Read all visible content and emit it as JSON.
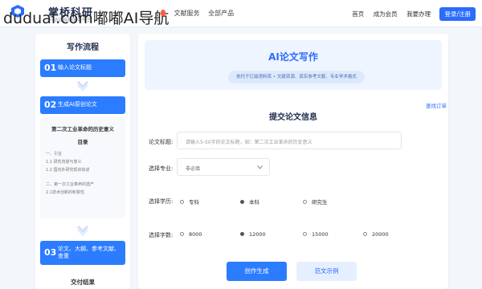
{
  "header": {
    "brand": "掌桥科研",
    "brand_sub": "一站式科研服务平台",
    "watermark": "duduai.com嘟嘟AI导航",
    "nav": [
      "文献服务",
      "全部产品"
    ],
    "right_nav": [
      "首页",
      "成为会员",
      "我要办理"
    ],
    "login_label": "登录/注册"
  },
  "left": {
    "title": "写作流程",
    "steps": [
      {
        "num": "01",
        "text": "输入论文标题"
      },
      {
        "num": "02",
        "text": "生成AI原创论文"
      },
      {
        "num": "03",
        "text": "论文、大纲、参考文献、查重"
      }
    ],
    "doc": {
      "title": "第二次工业革命的历史意义",
      "toc": "目录",
      "lines": [
        "一、引言",
        "1.1 研究背景与意义",
        "1.2 国内外研究现状综述",
        "二、第一次工业革命的遗产",
        "2.1技术创新的积累性"
      ]
    },
    "deliver": "交付结果"
  },
  "main": {
    "hero_title": "AI论文写作",
    "hero_pill": "依托千亿级语料库 • 文献资源、真实参考文献、专业学术格式",
    "query_link": "查找订单",
    "form_title": "提交论文信息",
    "title_label": "论文标题:",
    "title_placeholder": "请输入5-50字的论文标题，如：第二次工业革命的历史意义",
    "major_label": "选择专业:",
    "major_value": "非必填",
    "degree_label": "选择学历:",
    "degree_options": [
      {
        "label": "专科",
        "checked": false
      },
      {
        "label": "本科",
        "checked": true
      },
      {
        "label": "研究生",
        "checked": false
      }
    ],
    "words_label": "选择字数:",
    "word_options": [
      {
        "label": "8000",
        "checked": false
      },
      {
        "label": "12000",
        "checked": true
      },
      {
        "label": "15000",
        "checked": false
      },
      {
        "label": "20000",
        "checked": false
      }
    ],
    "generate_label": "创作生成",
    "example_label": "范文示例"
  },
  "colors": {
    "accent": "#2b7cff",
    "hero_bg": "#eef5fe",
    "hot": "#ff5a3c"
  }
}
